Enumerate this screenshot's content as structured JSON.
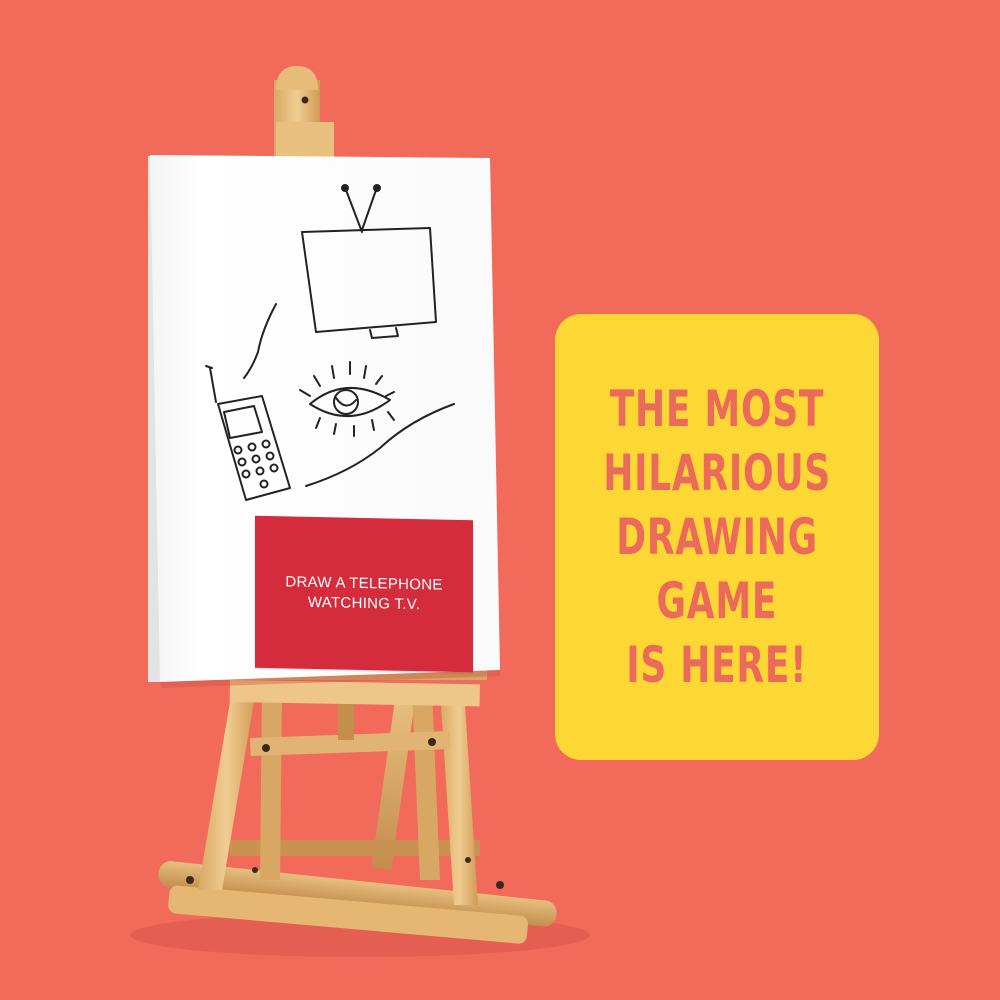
{
  "background_color": "#f26a5a",
  "card": {
    "line1": "DRAW A TELEPHONE",
    "line2": "WATCHING T.V.",
    "color": "#d42c3c"
  },
  "promo": {
    "lines": [
      "THE MOST",
      "HILARIOUS",
      "DRAWING",
      "GAME",
      "IS HERE!"
    ],
    "box_color": "#fdd835",
    "text_color": "#ec6a59"
  },
  "drawing": {
    "subjects": [
      "tv-icon",
      "eye-icon",
      "mobile-phone-icon"
    ]
  }
}
